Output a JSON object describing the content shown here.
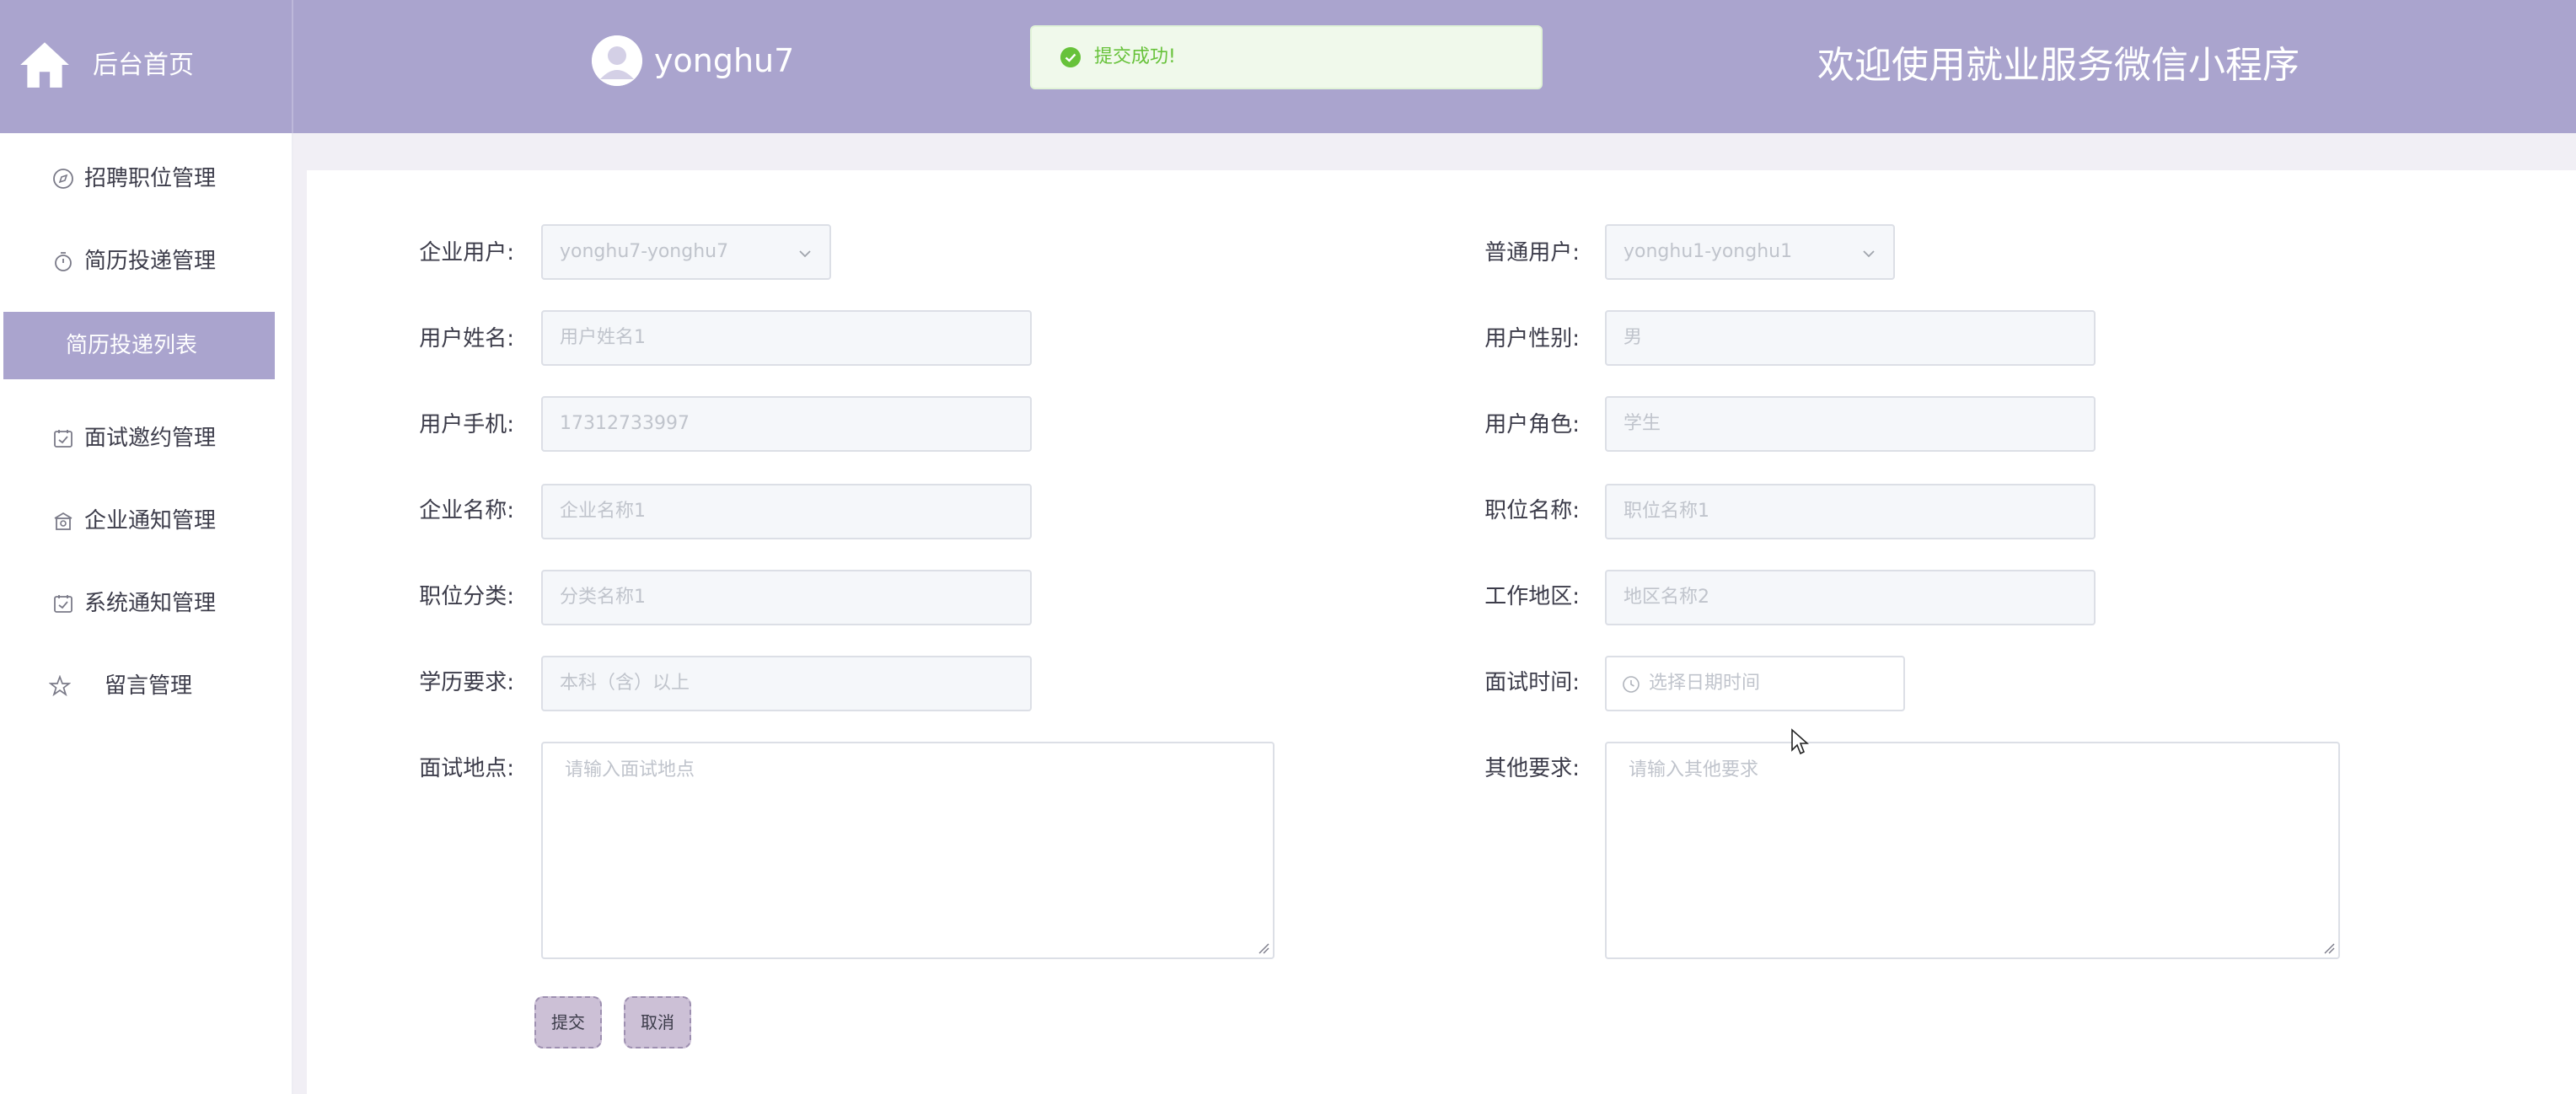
{
  "header": {
    "home_label": "后台首页",
    "username": "yonghu7",
    "toast_message": "提交成功!",
    "welcome_title": "欢迎使用就业服务微信小程序",
    "colors": {
      "header_bg": "#aaa4ce",
      "toast_bg": "#f0f9eb",
      "toast_text": "#67c23a"
    }
  },
  "sidebar": {
    "items": [
      {
        "label": "招聘职位管理",
        "icon": "compass-icon"
      },
      {
        "label": "简历投递管理",
        "icon": "timer-icon"
      },
      {
        "label": "简历投递列表",
        "icon": "",
        "active": true
      },
      {
        "label": "面试邀约管理",
        "icon": "calendar-check-icon"
      },
      {
        "label": "企业通知管理",
        "icon": "building-icon"
      },
      {
        "label": "系统通知管理",
        "icon": "calendar-check-icon"
      },
      {
        "label": "留言管理",
        "icon": "star-icon"
      }
    ]
  },
  "form": {
    "company_user": {
      "label": "企业用户:",
      "value": "yonghu7-yonghu7"
    },
    "normal_user": {
      "label": "普通用户:",
      "value": "yonghu1-yonghu1"
    },
    "user_name": {
      "label": "用户姓名:",
      "placeholder": "用户姓名1"
    },
    "user_gender": {
      "label": "用户性别:",
      "placeholder": "男"
    },
    "user_phone": {
      "label": "用户手机:",
      "placeholder": "17312733997"
    },
    "user_role": {
      "label": "用户角色:",
      "placeholder": "学生"
    },
    "company_name": {
      "label": "企业名称:",
      "placeholder": "企业名称1"
    },
    "job_title": {
      "label": "职位名称:",
      "placeholder": "职位名称1"
    },
    "job_category": {
      "label": "职位分类:",
      "placeholder": "分类名称1"
    },
    "work_area": {
      "label": "工作地区:",
      "placeholder": "地区名称2"
    },
    "education": {
      "label": "学历要求:",
      "placeholder": "本科（含）以上"
    },
    "interview_time": {
      "label": "面试时间:",
      "placeholder": "选择日期时间"
    },
    "interview_place": {
      "label": "面试地点:",
      "placeholder": "请输入面试地点"
    },
    "other_requirements": {
      "label": "其他要求:",
      "placeholder": "请输入其他要求"
    },
    "submit_label": "提交",
    "cancel_label": "取消"
  }
}
